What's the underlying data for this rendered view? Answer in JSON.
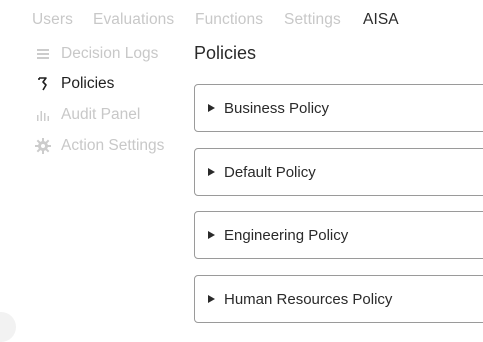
{
  "topnav": {
    "items": [
      {
        "label": "Users"
      },
      {
        "label": "Evaluations"
      },
      {
        "label": "Functions"
      },
      {
        "label": "Settings"
      },
      {
        "label": "AISA"
      }
    ]
  },
  "sidebar": {
    "items": [
      {
        "label": "Decision Logs",
        "icon": "list-icon"
      },
      {
        "label": "Policies",
        "icon": "policy-icon"
      },
      {
        "label": "Audit Panel",
        "icon": "bar-chart-icon"
      },
      {
        "label": "Action Settings",
        "icon": "gear-icon"
      }
    ]
  },
  "main": {
    "title": "Policies",
    "policies": [
      {
        "label": "Business Policy"
      },
      {
        "label": "Default Policy"
      },
      {
        "label": "Engineering Policy"
      },
      {
        "label": "Human Resources Policy"
      }
    ]
  },
  "colors": {
    "dim_text": "#c8c8c8",
    "active_text": "#1f1f1f",
    "card_border": "#9a9a9a"
  }
}
